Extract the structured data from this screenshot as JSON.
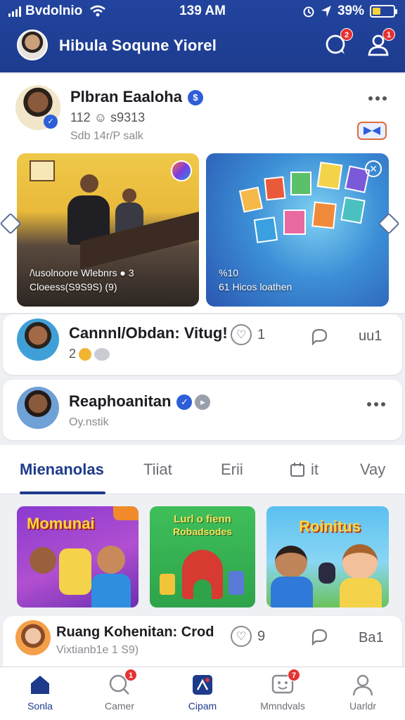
{
  "status": {
    "carrier": "Bvdolnio",
    "time": "139 AM",
    "battery": "39%",
    "battery_fraction": 0.39
  },
  "header": {
    "title": "Hibula Soqune Yiorel",
    "messages_badge": "2",
    "profile_badge": "1"
  },
  "post1": {
    "author": "Plbran Eaaloha",
    "stats": "112 ☺ s9313",
    "meta": "Sdb 14r/P salk",
    "tiles": [
      {
        "caption_line1": "/\\usolnoore Wlebnrs ● 3",
        "caption_line2": "Cloeess(S9S9S) (9)"
      },
      {
        "caption_line1": "%10",
        "caption_line2": "61 Hicos loathen"
      }
    ]
  },
  "post2": {
    "author": "Cannnl/Obdan: Vitug!",
    "count": "2",
    "likes": "1",
    "views": "uu1"
  },
  "post3": {
    "author": "Reaphoanitan",
    "meta": "Oy.nstik"
  },
  "tabs": [
    {
      "label": "Mienanolas"
    },
    {
      "label": "Tiiat"
    },
    {
      "label": "Erii"
    },
    {
      "label": "it"
    },
    {
      "label": "Vay"
    }
  ],
  "games": [
    {
      "title": "Momunai",
      "corner": "tag"
    },
    {
      "title_line1": "Lurl o fienn",
      "title_line2": "Robadsodes"
    },
    {
      "title": "Roinitus"
    }
  ],
  "post4": {
    "author": "Ruang Kohenitan: Crod",
    "meta": "Vixtianb1e 1 S9)",
    "likes": "9",
    "views": "Ba1"
  },
  "nav": [
    {
      "label": "Sonla",
      "icon": "home-icon"
    },
    {
      "label": "Camer",
      "icon": "search-icon",
      "badge": "1"
    },
    {
      "label": "Cipam",
      "icon": "game-icon"
    },
    {
      "label": "Mmndvals",
      "icon": "chat-face-icon",
      "badge": "7"
    },
    {
      "label": "Uarldr",
      "icon": "profile-icon"
    }
  ]
}
